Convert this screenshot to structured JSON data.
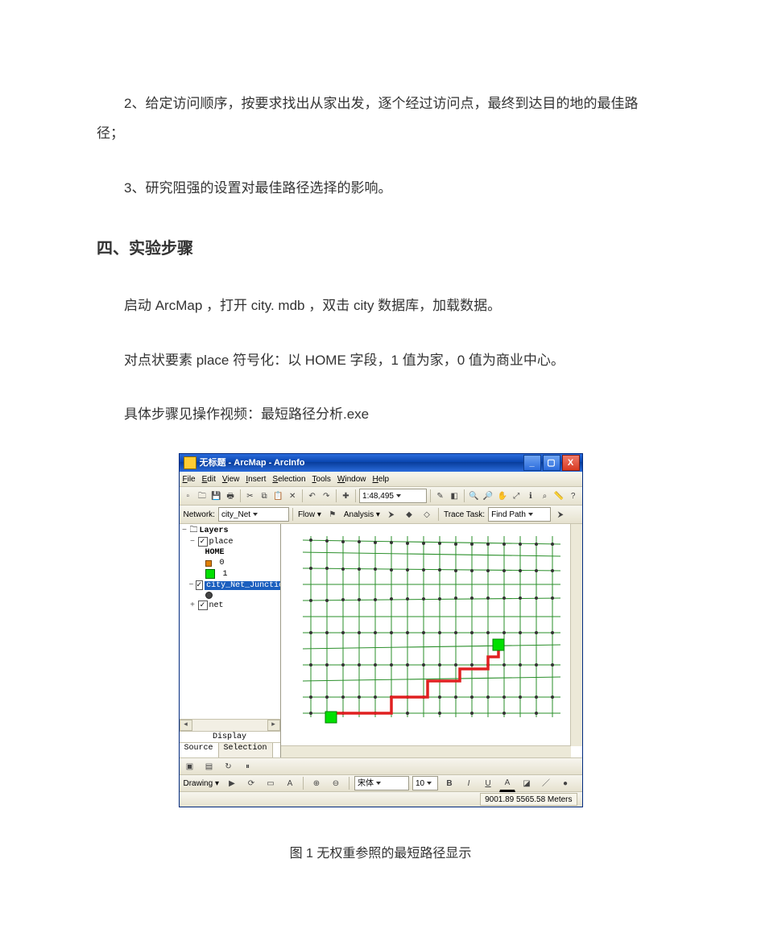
{
  "doc": {
    "p1": "2、给定访问顺序，按要求找出从家出发，逐个经过访问点，最终到达目的地的最佳路径；",
    "p2": "3、研究阻强的设置对最佳路径选择的影响。",
    "h1": "四、实验步骤",
    "p3": "启动 ArcMap   ，打开 city. mdb   ，双击 city 数据库，加载数据。",
    "p4": "对点状要素 place 符号化：以 HOME 字段，1 值为家，0 值为商业中心。",
    "p5": "具体步骤见操作视频：最短路径分析.exe",
    "caption": "图 1  无权重参照的最短路径显示"
  },
  "arcmap": {
    "title": "无标题 - ArcMap - ArcInfo",
    "menus": [
      "File",
      "Edit",
      "View",
      "Insert",
      "Selection",
      "Tools",
      "Window",
      "Help"
    ],
    "scale": "1:48,495",
    "networkLabel": "Network:",
    "networkValue": "city_Net",
    "flowLabel": "Flow",
    "analysisLabel": "Analysis",
    "traceLabel": "Trace Task:",
    "traceValue": "Find Path",
    "toc": {
      "root": "Layers",
      "place": "place",
      "placeField": "HOME",
      "val0": "0",
      "val1": "1",
      "cityNetJunc": "city_Net_Junctions",
      "net": "net",
      "displayLabel": "Display",
      "tabSource": "Source",
      "tabSelection": "Selection"
    },
    "drawingLabel": "Drawing",
    "fontName": "宋体",
    "fontSize": "10",
    "status": {
      "coords": "9001.89  5565.58 Meters"
    },
    "ctrl": {
      "min": "_",
      "max": "▢",
      "close": "X"
    }
  }
}
